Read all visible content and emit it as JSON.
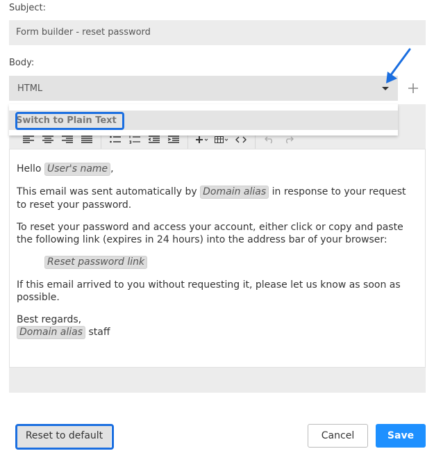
{
  "subject": {
    "label": "Subject:",
    "value": "Form builder - reset password"
  },
  "body": {
    "label": "Body:",
    "format_selected": "HTML",
    "add_icon": "plus-icon",
    "dropdown_option": "Switch to Plain Text"
  },
  "toolbar": {
    "icons": [
      "align-left-icon",
      "align-center-icon",
      "align-right-icon",
      "align-justify-icon",
      "bullet-list-icon",
      "numbered-list-icon",
      "outdent-icon",
      "indent-icon",
      "insert-icon",
      "table-icon",
      "code-icon",
      "undo-icon",
      "redo-icon"
    ]
  },
  "email": {
    "greeting": "Hello",
    "user_name_tag": "User's name",
    "greeting_comma": ",",
    "line1_pre": "This email was sent automatically by",
    "domain_alias_tag": "Domain alias",
    "line1_post": "in response to your request to reset your password.",
    "line2": "To reset your password and access your account, either click or copy and paste the following link (expires in 24 hours) into the address bar of your browser:",
    "reset_link_tag": "Reset password link",
    "line3": "If this email arrived to you without requesting it, please let us know as soon as possible.",
    "closing": "Best regards,",
    "signature_tag": "Domain alias",
    "signature_post": "staff"
  },
  "actions": {
    "reset_label": "Reset to default",
    "cancel_label": "Cancel",
    "save_label": "Save"
  },
  "colors": {
    "accent": "#1e90ff",
    "highlight": "#1a6ee0"
  }
}
